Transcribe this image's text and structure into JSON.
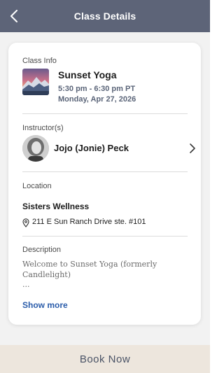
{
  "header": {
    "title": "Class Details"
  },
  "class_info": {
    "section_label": "Class Info",
    "name": "Sunset Yoga",
    "time": "5:30 pm - 6:30 pm PT",
    "date": "Monday, Apr 27, 2026"
  },
  "instructor": {
    "section_label": "Instructor(s)",
    "name": "Jojo (Jonie) Peck"
  },
  "location": {
    "section_label": "Location",
    "name": "Sisters Wellness",
    "address": "211 E Sun Ranch Drive ste. #101"
  },
  "description": {
    "section_label": "Description",
    "text": "Welcome to Sunset Yoga (formerly Candlelight)",
    "ellipsis": "...",
    "show_more_label": "Show more"
  },
  "footer": {
    "book_label": "Book Now"
  },
  "colors": {
    "header_bg": "#5d6478",
    "accent_link": "#2a5caa",
    "footer_bg": "#ede6dd"
  }
}
